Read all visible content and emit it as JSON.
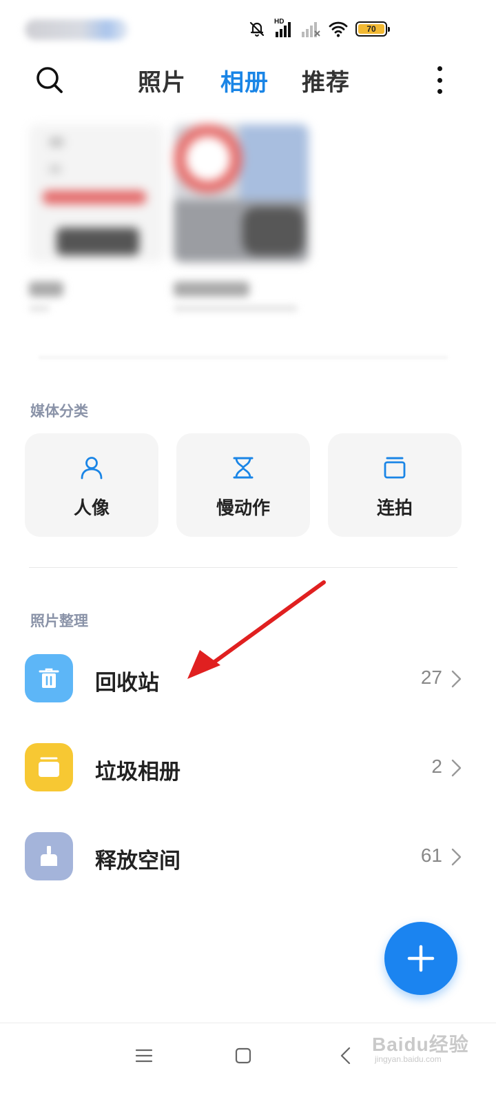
{
  "status_bar": {
    "network_badge": "HD",
    "battery_level": "70",
    "icons": [
      "mute-bell-icon",
      "signal-hd-icon",
      "signal-weak-icon",
      "wifi-icon",
      "battery-icon"
    ],
    "battery_color": "#f2b933"
  },
  "top_bar": {
    "tabs": [
      {
        "label": "照片",
        "active": false
      },
      {
        "label": "相册",
        "active": true
      },
      {
        "label": "推荐",
        "active": false
      }
    ],
    "active_color": "#1a85e6",
    "icons": [
      "search-icon",
      "more-vertical-icon"
    ]
  },
  "media_section": {
    "title": "媒体分类",
    "items": [
      {
        "label": "人像",
        "icon": "portrait-icon"
      },
      {
        "label": "慢动作",
        "icon": "hourglass-icon"
      },
      {
        "label": "连拍",
        "icon": "burst-icon"
      }
    ],
    "icon_color": "#1a85e6"
  },
  "organize_section": {
    "title": "照片整理",
    "items": [
      {
        "label": "回收站",
        "count": "27",
        "icon": "trash-icon",
        "color": "#5db6f7"
      },
      {
        "label": "垃圾相册",
        "count": "2",
        "icon": "junk-album-icon",
        "color": "#f7c833"
      },
      {
        "label": "释放空间",
        "count": "61",
        "icon": "broom-icon",
        "color": "#a4b4da"
      }
    ]
  },
  "fab": {
    "icon": "plus-icon",
    "color": "#1b84f0"
  },
  "nav_bar": {
    "icons": [
      "menu-icon",
      "home-icon",
      "back-icon"
    ]
  },
  "watermark": {
    "main": "Baidu经验",
    "sub": "jingyan.baidu.com"
  },
  "annotation": {
    "color": "#e02020"
  }
}
